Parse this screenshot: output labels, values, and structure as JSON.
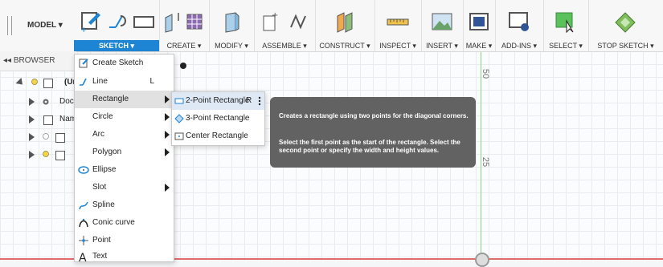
{
  "toolbar": {
    "model_label": "MODEL ▾",
    "sketch_label": "SKETCH ▾",
    "create_label": "CREATE ▾",
    "modify_label": "MODIFY ▾",
    "assemble_label": "ASSEMBLE ▾",
    "construct_label": "CONSTRUCT ▾",
    "inspect_label": "INSPECT ▾",
    "insert_label": "INSERT ▾",
    "make_label": "MAKE ▾",
    "addins_label": "ADD-INS ▾",
    "select_label": "SELECT ▾",
    "stop_sketch_label": "STOP SKETCH ▾"
  },
  "browser": {
    "header": "◂◂ BROWSER",
    "items": [
      {
        "label": "(Un"
      },
      {
        "label": "Docu"
      },
      {
        "label": "Nam"
      }
    ]
  },
  "sketch_menu": {
    "items": [
      {
        "label": "Create Sketch",
        "shortcut": ""
      },
      {
        "label": "Line",
        "shortcut": "L"
      },
      {
        "label": "Rectangle",
        "shortcut": ""
      },
      {
        "label": "Circle",
        "shortcut": ""
      },
      {
        "label": "Arc",
        "shortcut": ""
      },
      {
        "label": "Polygon",
        "shortcut": ""
      },
      {
        "label": "Ellipse",
        "shortcut": ""
      },
      {
        "label": "Slot",
        "shortcut": ""
      },
      {
        "label": "Spline",
        "shortcut": ""
      },
      {
        "label": "Conic curve",
        "shortcut": ""
      },
      {
        "label": "Point",
        "shortcut": ""
      },
      {
        "label": "Text",
        "shortcut": ""
      }
    ]
  },
  "rectangle_submenu": {
    "items": [
      {
        "label": "2-Point Rectangle",
        "shortcut": "R"
      },
      {
        "label": "3-Point Rectangle",
        "shortcut": ""
      },
      {
        "label": "Center Rectangle",
        "shortcut": ""
      }
    ]
  },
  "tooltip": {
    "line1": "Creates a rectangle using two points for the diagonal corners.",
    "line2": "Select the first point as the start of the rectangle. Select the second point or specify the width and height values."
  },
  "canvas": {
    "coord_50": "50",
    "coord_25": "25"
  },
  "colors": {
    "accent": "#1e84d4",
    "tooltip_bg": "#626262",
    "axis_green": "#8ed28e",
    "axis_red": "#e36a6a"
  },
  "icons": [
    "create-sketch-icon",
    "line-icon",
    "rectangle-icon",
    "ellipse-icon",
    "spline-icon",
    "conic-curve-icon",
    "point-icon",
    "text-icon"
  ]
}
